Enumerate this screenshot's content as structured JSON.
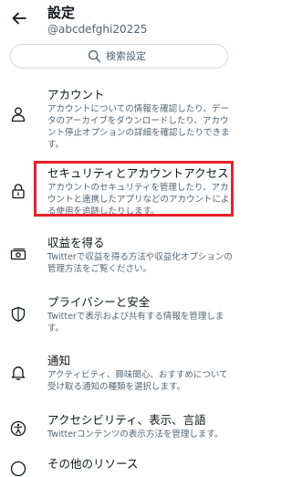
{
  "header": {
    "title": "設定",
    "username": "@abcdefghi20225"
  },
  "search": {
    "placeholder": "検索設定"
  },
  "items": [
    {
      "icon": "person-icon",
      "title": "アカウント",
      "desc": "アカウントについての情報を確認したり、データのアーカイブをダウンロードしたり、アカウント停止オプションの詳細を確認したりできます。"
    },
    {
      "icon": "lock-icon",
      "title": "セキュリティとアカウントアクセス",
      "desc": "アカウントのセキュリティを管理したり、アカウントと連携したアプリなどのアカウントによる使用を追跡したりします。"
    },
    {
      "icon": "money-icon",
      "title": "収益を得る",
      "desc": "Twitterで収益を得る方法や収益化オプションの管理方法をご覧ください。"
    },
    {
      "icon": "shield-icon",
      "title": "プライバシーと安全",
      "desc": "Twitterで表示および共有する情報を管理します。"
    },
    {
      "icon": "bell-icon",
      "title": "通知",
      "desc": "アクティビティ、興味関心、おすすめについて受け取る通知の種類を選択します。"
    },
    {
      "icon": "accessibility-icon",
      "title": "アクセシビリティ、表示、言語",
      "desc": "Twitterコンテンツの表示方法を管理します。"
    },
    {
      "icon": "more-icon",
      "title": "その他のリソース",
      "desc": ""
    }
  ],
  "colors": {
    "highlight": "#e8202a",
    "text_primary": "#0f1419",
    "text_secondary": "#536471",
    "border": "#cfd9de"
  }
}
